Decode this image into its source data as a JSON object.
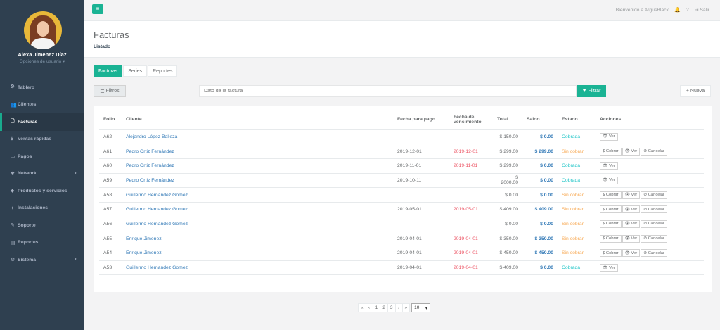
{
  "user": {
    "name": "Alexa Jimenez Díaz",
    "options_label": "Opciones de usuario ▾"
  },
  "sidebar": {
    "items": [
      {
        "icon": "tachometer-icon",
        "glyph": "⏲",
        "label": "Tablero",
        "active": false,
        "has_arrow": false
      },
      {
        "icon": "users-icon",
        "glyph": "👥",
        "label": "Clientes",
        "active": false,
        "has_arrow": false
      },
      {
        "icon": "file-icon",
        "glyph": "🗋",
        "label": "Facturas",
        "active": true,
        "has_arrow": false
      },
      {
        "icon": "dollar-icon",
        "glyph": "$",
        "label": "Ventas rápidas",
        "active": false,
        "has_arrow": false
      },
      {
        "icon": "money-icon",
        "glyph": "▭",
        "label": "Pagos",
        "active": false,
        "has_arrow": false
      },
      {
        "icon": "network-icon",
        "glyph": "✱",
        "label": "Network",
        "active": false,
        "has_arrow": true
      },
      {
        "icon": "tags-icon",
        "glyph": "◆",
        "label": "Productos y servicios",
        "active": false,
        "has_arrow": false
      },
      {
        "icon": "wrench-icon",
        "glyph": "✦",
        "label": "Instalaciones",
        "active": false,
        "has_arrow": false
      },
      {
        "icon": "tool-icon",
        "glyph": "✎",
        "label": "Soporte",
        "active": false,
        "has_arrow": false
      },
      {
        "icon": "book-icon",
        "glyph": "▤",
        "label": "Reportes",
        "active": false,
        "has_arrow": false
      },
      {
        "icon": "cogs-icon",
        "glyph": "⚙",
        "label": "Sistema",
        "active": false,
        "has_arrow": true
      }
    ]
  },
  "topbar": {
    "hamburger": "≡",
    "welcome": "Bienvenido a ArgusBlack",
    "bell": "🔔",
    "help": "?",
    "logout_glyph": "⇥",
    "logout_label": "Salir"
  },
  "heading": {
    "title": "Facturas",
    "breadcrumb": "Listado"
  },
  "tabs": [
    {
      "label": "Facturas",
      "active": true
    },
    {
      "label": "Series",
      "active": false
    },
    {
      "label": "Reportes",
      "active": false
    }
  ],
  "filters": {
    "filtros_label": "Filtros",
    "search_placeholder": "Dato de la factura",
    "filtrar_label": "Filtrar",
    "nueva_label": "Nueva"
  },
  "table": {
    "headers": {
      "folio": "Folio",
      "cliente": "Cliente",
      "fecha_pago": "Fecha para pago",
      "fecha_venc": "Fecha de vencimiento",
      "total": "Total",
      "saldo": "Saldo",
      "estado": "Estado",
      "acciones": "Acciones"
    },
    "action_labels": {
      "cobrar": "$ Cobrar",
      "ver": "👁 Ver",
      "cancelar": "⊘ Cancelar"
    },
    "rows": [
      {
        "folio": "A62",
        "cliente": "Alejandro López Balleza",
        "fecha_pago": "",
        "fecha_venc": "",
        "total": "$ 150.00",
        "saldo": "$ 0.00",
        "estado": "Cobrada",
        "status": "cobrada"
      },
      {
        "folio": "A61",
        "cliente": "Pedro Ortiz Fernández",
        "fecha_pago": "2019-12-01",
        "fecha_venc": "2019-12-01",
        "total": "$ 299.00",
        "saldo": "$ 299.00",
        "estado": "Sin cobrar",
        "status": "sin"
      },
      {
        "folio": "A60",
        "cliente": "Pedro Ortiz Fernández",
        "fecha_pago": "2019-11-01",
        "fecha_venc": "2019-11-01",
        "total": "$ 299.00",
        "saldo": "$ 0.00",
        "estado": "Cobrada",
        "status": "cobrada"
      },
      {
        "folio": "A59",
        "cliente": "Pedro Ortiz Fernández",
        "fecha_pago": "2019-10-11",
        "fecha_venc": "",
        "total": "$ 2000.00",
        "saldo": "$ 0.00",
        "estado": "Cobrada",
        "status": "cobrada"
      },
      {
        "folio": "A58",
        "cliente": "Guillermo Hernandez Gomez",
        "fecha_pago": "",
        "fecha_venc": "",
        "total": "$ 0.00",
        "saldo": "$ 0.00",
        "estado": "Sin cobrar",
        "status": "sin"
      },
      {
        "folio": "A57",
        "cliente": "Guillermo Hernandez Gomez",
        "fecha_pago": "2019-05-01",
        "fecha_venc": "2019-05-01",
        "total": "$ 409.00",
        "saldo": "$ 409.00",
        "estado": "Sin cobrar",
        "status": "sin"
      },
      {
        "folio": "A56",
        "cliente": "Guillermo Hernandez Gomez",
        "fecha_pago": "",
        "fecha_venc": "",
        "total": "$ 0.00",
        "saldo": "$ 0.00",
        "estado": "Sin cobrar",
        "status": "sin"
      },
      {
        "folio": "A55",
        "cliente": "Enrique Jimenez",
        "fecha_pago": "2019-04-01",
        "fecha_venc": "2019-04-01",
        "total": "$ 350.00",
        "saldo": "$ 350.00",
        "estado": "Sin cobrar",
        "status": "sin"
      },
      {
        "folio": "A54",
        "cliente": "Enrique Jimenez",
        "fecha_pago": "2019-04-01",
        "fecha_venc": "2019-04-01",
        "total": "$ 450.00",
        "saldo": "$ 450.00",
        "estado": "Sin cobrar",
        "status": "sin"
      },
      {
        "folio": "A53",
        "cliente": "Guillermo Hernandez Gomez",
        "fecha_pago": "2019-04-01",
        "fecha_venc": "2019-04-01",
        "total": "$ 409.00",
        "saldo": "$ 0.00",
        "estado": "Cobrada",
        "status": "cobrada"
      }
    ]
  },
  "pagination": {
    "first": "«",
    "prev": "‹",
    "pages": [
      "1",
      "2",
      "3"
    ],
    "next": "›",
    "last": "»",
    "page_size": "10",
    "size_caret": "▾"
  },
  "colors": {
    "sidebar_bg": "#2f4050",
    "accent": "#1ab394",
    "link": "#337ab7",
    "danger": "#ed5565",
    "warning": "#f8ac59",
    "info": "#23c6c8"
  }
}
